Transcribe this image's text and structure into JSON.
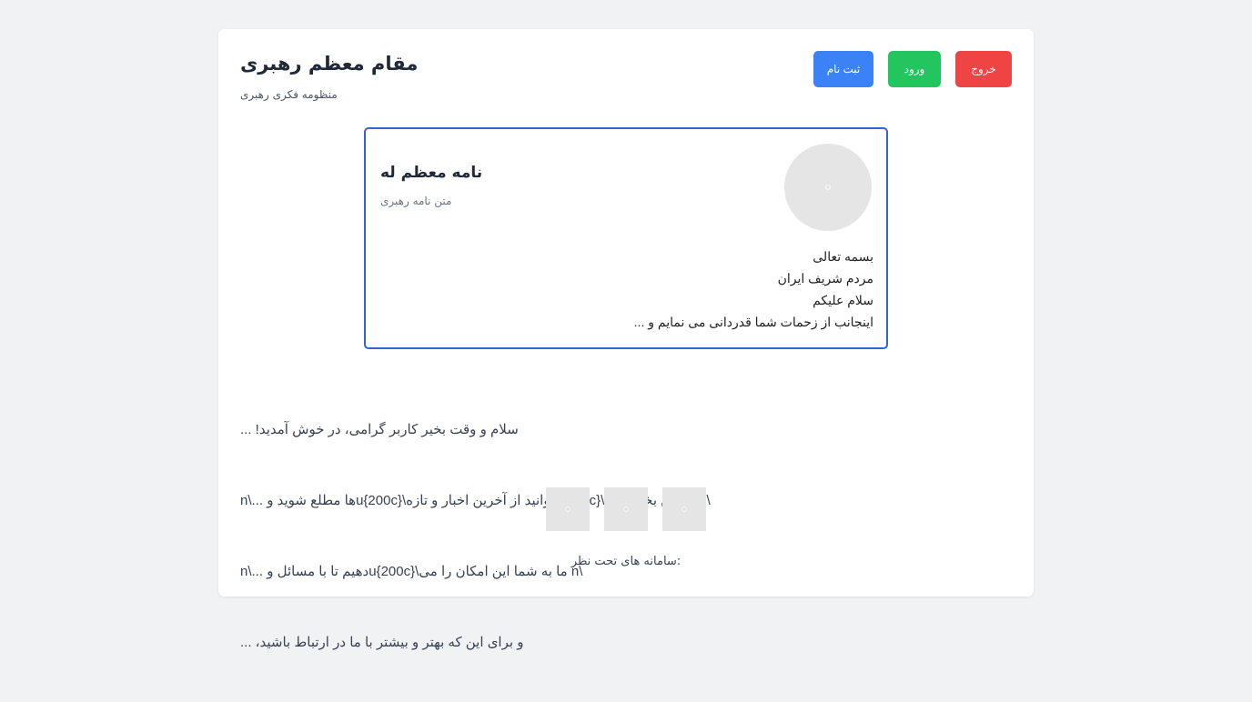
{
  "header": {
    "title": "مقام معظم رهبری",
    "subtitle": "منظومه فکری رهبری",
    "buttons": {
      "logout": "خروج",
      "login": "ورود",
      "register": "ثبت نام"
    }
  },
  "letter": {
    "title": "نامه معظم له",
    "subtitle": "متن نامه رهبری",
    "avatar_icon": "image-placeholder-icon",
    "lines": [
      "بسمه تعالی",
      "مردم شریف ایران",
      "سلام علیکم",
      "اینجانب از زحمات شما قدردانی می نمایم و ..."
    ]
  },
  "welcome": {
    "lines": [
      "... !سلام و وقت بخیر کاربر گرامی، در خوش آمدید",
      "n\\... ها مطلع شوید وu{200c}\\توانید از آخرین اخبار و تازهu{200c}\\در این بخش می n\\",
      "n\\... دهیم تا با مسائل وu{200c}\\ما به شما این امکان را می n\\",
      "... ،و برای این که بهتر و بیشتر با ما در ارتباط باشید"
    ]
  },
  "systems": {
    "label": ":سامانه های تحت نظر",
    "items": [
      "system-image-icon",
      "system-image-icon",
      "system-image-icon"
    ]
  },
  "colors": {
    "logout": "#ef4444",
    "login": "#22c55e",
    "register": "#3b82f6",
    "letter_border": "#3266cc"
  }
}
